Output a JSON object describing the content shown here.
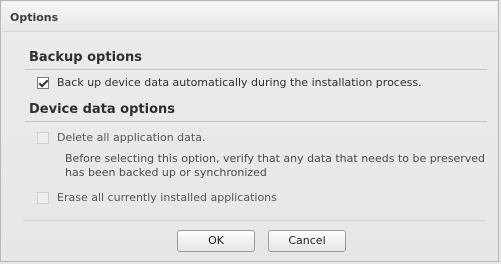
{
  "window": {
    "title": "Options"
  },
  "sections": {
    "backup": {
      "title": "Backup options",
      "option": {
        "label": "Back up device data automatically during the installation process.",
        "checked": true
      }
    },
    "device": {
      "title": "Device data options",
      "delete_all": {
        "label": "Delete all application data.",
        "checked": false
      },
      "delete_note": "Before selecting this option, verify that any data that needs to be preserved has been backed up or synchronized",
      "erase_all": {
        "label": "Erase all currently installed applications",
        "checked": false
      }
    }
  },
  "buttons": {
    "ok_label": "OK",
    "cancel_label": "Cancel"
  }
}
